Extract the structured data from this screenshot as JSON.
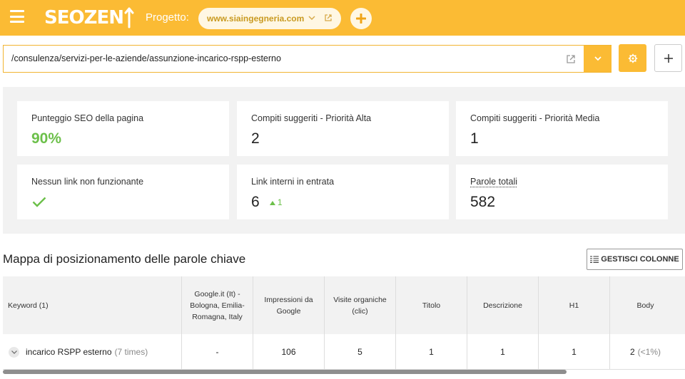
{
  "header": {
    "logo_text": "SEOZEN",
    "project_label": "Progetto:",
    "project_domain": "www.siaingegneria.com",
    "brand_color": "#fbbb34"
  },
  "url_bar": {
    "path": "/consulenza/servizi-per-le-aziende/assunzione-incarico-rspp-esterno"
  },
  "stats": {
    "seo_score": {
      "label": "Punteggio SEO della pagina",
      "value": "90%"
    },
    "high_priority": {
      "label": "Compiti suggeriti - Priorità Alta",
      "value": "2"
    },
    "medium_priority": {
      "label": "Compiti suggeriti - Priorità Media",
      "value": "1"
    },
    "broken_links": {
      "label": "Nessun link non funzionante",
      "icon": "check-icon"
    },
    "internal_links": {
      "label": "Link interni in entrata",
      "value": "6",
      "trend": "1"
    },
    "total_words": {
      "label": "Parole totali",
      "value": "582"
    }
  },
  "keyword_map": {
    "title": "Mappa di posizionamento delle parole chiave",
    "manage_button": "GESTISCI COLONNE",
    "columns": [
      "Keyword (1)",
      "Google.it (It) - Bologna, Emilia-Romagna, Italy",
      "Impressioni da Google",
      "Visite organiche (clic)",
      "Titolo",
      "Descrizione",
      "H1",
      "Body"
    ],
    "rows": [
      {
        "keyword": "incarico RSPP esterno",
        "times": "(7 times)",
        "position": "-",
        "impressions": "106",
        "visits": "5",
        "title": "1",
        "description": "1",
        "h1": "1",
        "body": "2",
        "body_pct": "(<1%)"
      }
    ]
  }
}
